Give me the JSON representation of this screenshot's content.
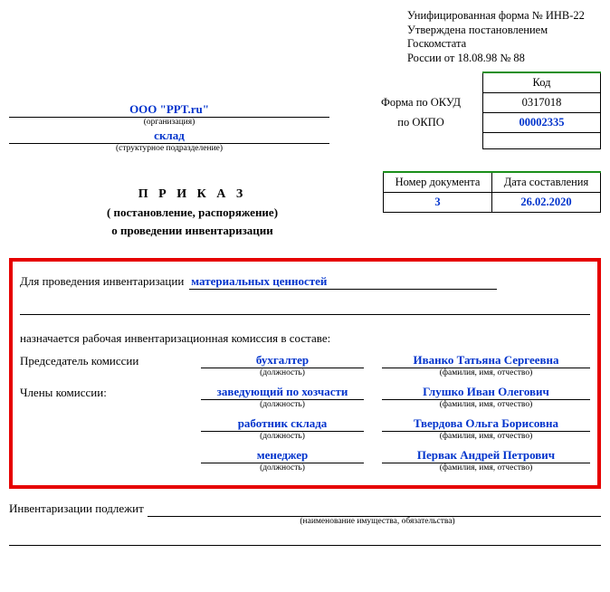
{
  "topNote": {
    "line1": "Унифицированная форма № ИНВ-22",
    "line2": "Утверждена постановлением Госкомстата",
    "line3": "России от 18.08.98 № 88"
  },
  "codeBox": {
    "kodLabel": "Код",
    "okudLabel": "Форма по ОКУД",
    "okudValue": "0317018",
    "okpoLabel": "по ОКПО",
    "okpoValue": "00002335"
  },
  "org": {
    "value": "ООО \"PPT.ru\"",
    "caption": "(организация)"
  },
  "unit": {
    "value": "склад",
    "caption": "(структурное подразделение)"
  },
  "docMeta": {
    "numLabel": "Номер документа",
    "dateLabel": "Дата составления",
    "numValue": "3",
    "dateValue": "26.02.2020"
  },
  "orderTitle": "П Р И К А З",
  "orderSub1": "( постановление, распоряжение)",
  "orderSub2": "о проведении инвентаризации",
  "purpose": {
    "prefix": "Для проведения инвентаризации",
    "value": "материальных ценностей"
  },
  "assignText": "назначается рабочая инвентаризационная комиссия в составе:",
  "commLabels": {
    "chairman": "Председатель комиссии",
    "members": "Члены комиссии:",
    "posCap": "(должность)",
    "nameCap": "(фамилия, имя, отчество)"
  },
  "commission": [
    {
      "pos": "бухгалтер",
      "name": "Иванко Татьяна Сергеевна"
    },
    {
      "pos": "заведующий по хозчасти",
      "name": "Глушко Иван Олегович"
    },
    {
      "pos": "работник склада",
      "name": "Твердова Ольга Борисовна"
    },
    {
      "pos": "менеджер",
      "name": "Первак Андрей Петрович"
    }
  ],
  "subject": {
    "label": "Инвентаризации подлежит",
    "caption": "(наименование имущества, обязательства)"
  }
}
